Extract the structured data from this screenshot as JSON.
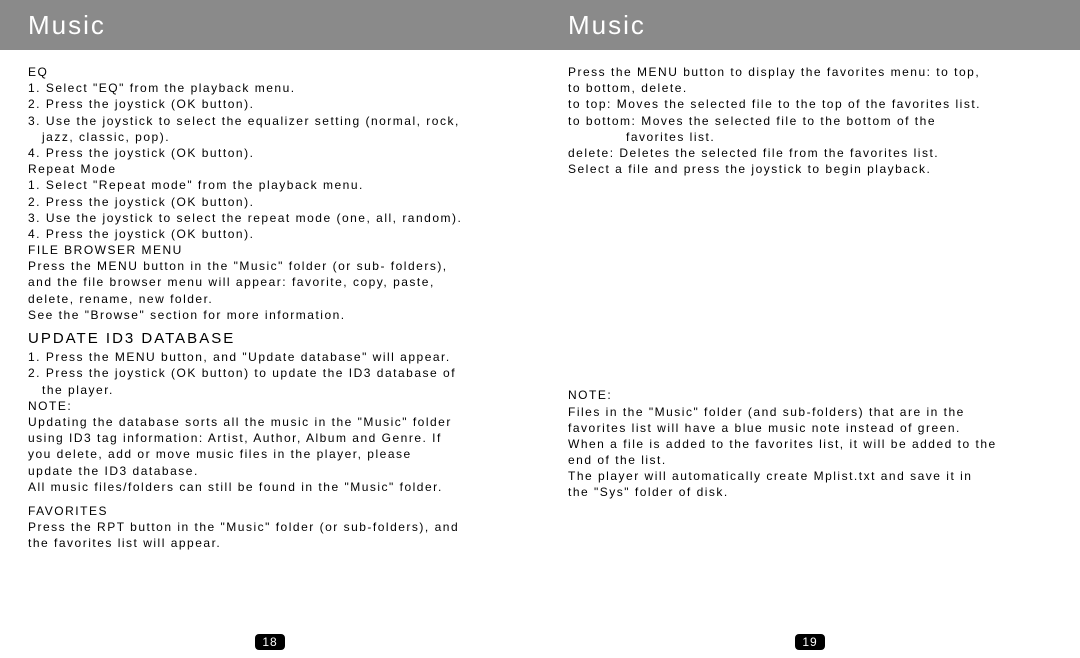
{
  "pages": {
    "p18": {
      "header": "Music",
      "eq_title": "EQ",
      "eq1": "1. Select \"EQ\" from the playback menu.",
      "eq2": "2. Press the joystick (OK button).",
      "eq3a": "3. Use the joystick to select the equalizer setting (normal, rock,",
      "eq3b": "jazz, classic, pop).",
      "eq4": "4. Press the joystick (OK button).",
      "rpt_title": "Repeat Mode",
      "rpt1": "1. Select \"Repeat mode\" from the playback menu.",
      "rpt2": "2. Press the joystick (OK button).",
      "rpt3": "3. Use the joystick to select the repeat mode (one, all, random).",
      "rpt4": "4. Press the joystick (OK button).",
      "fbm_title": "FILE BROWSER MENU",
      "fbm1": "Press the MENU button in the \"Music\" folder (or sub- folders),",
      "fbm2": "and the file browser menu will appear: favorite, copy, paste,",
      "fbm3": "delete, rename, new folder.",
      "fbm4": "See the \"Browse\" section for more information.",
      "upd_heading": "UPDATE ID3 DATABASE",
      "upd1": "1. Press the MENU button, and \"Update database\" will appear.",
      "upd2a": "2. Press the joystick (OK button) to update the ID3 database of",
      "upd2b": "the player.",
      "note_label": "NOTE:",
      "note1": "Updating the database sorts all the music in the \"Music\" folder",
      "note2": "using ID3 tag information: Artist, Author, Album and Genre. If",
      "note3": "you delete, add or move music files in the player, please",
      "note4": "update the ID3 database.",
      "note5": "All music files/folders can still be found in the \"Music\" folder.",
      "fav_title": "FAVORITES",
      "fav1": "Press the RPT button in the \"Music\" folder (or sub-folders), and",
      "fav2": "the favorites list will appear.",
      "page_num": "18"
    },
    "p19": {
      "header": "Music",
      "l1": "Press the MENU button to display the favorites menu: to top,",
      "l2": "to bottom, delete.",
      "l3": "to top: Moves the selected file to the top of the favorites list.",
      "l4a": "to bottom: Moves the selected file to the bottom of the",
      "l4b": "favorites list.",
      "l5": "delete: Deletes the selected file from the favorites list.",
      "l6": "Select a file and press the joystick to begin playback.",
      "note_label": "NOTE:",
      "n1": "Files in the \"Music\" folder (and sub-folders) that are in the",
      "n2": "favorites list will have a blue music note instead of green.",
      "n3": "When a file is added to the favorites list, it will be added to the",
      "n4": "end of the list.",
      "n5": "The player will automatically create Mplist.txt and save it in",
      "n6": "the \"Sys\" folder of disk.",
      "page_num": "19"
    }
  }
}
